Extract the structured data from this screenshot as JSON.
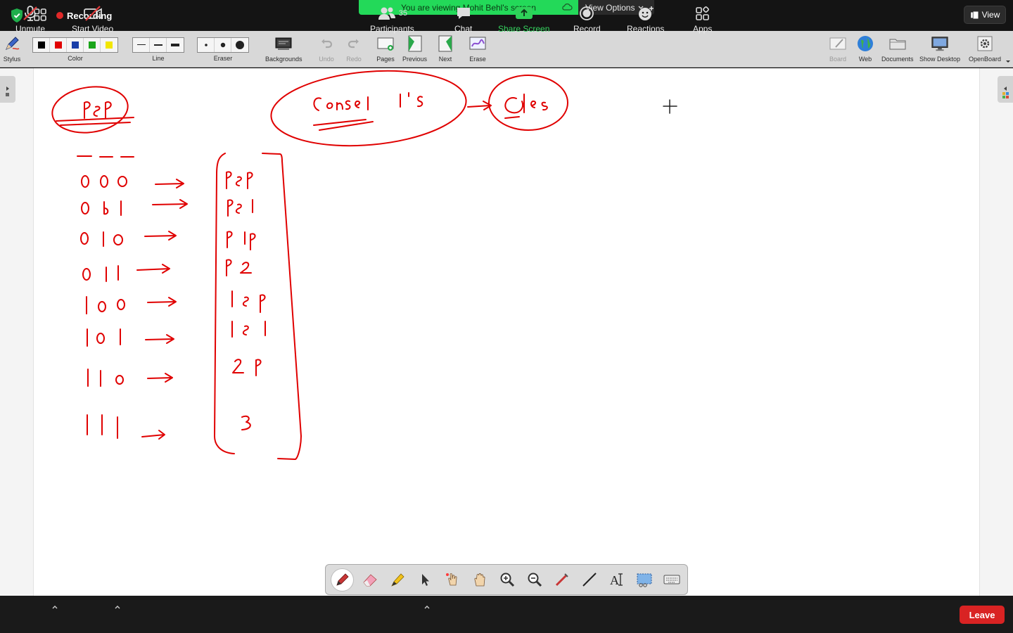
{
  "topbar": {
    "recording_label": "Recording",
    "viewing_banner": "You are viewing Mohit Behl's screen",
    "view_options_label": "View Options",
    "view_label": "View"
  },
  "annotate_toolbar": {
    "stylus": "Stylus",
    "color": "Color",
    "line": "Line",
    "eraser": "Eraser",
    "backgrounds": "Backgrounds",
    "undo": "Undo",
    "redo": "Redo",
    "pages": "Pages",
    "previous": "Previous",
    "next": "Next",
    "erase": "Erase",
    "board": "Board",
    "web": "Web",
    "documents": "Documents",
    "show_desktop": "Show Desktop",
    "openboard": "OpenBoard",
    "colors": [
      "#000000",
      "#e00000",
      "#1a3fa8",
      "#1aa51a",
      "#f2e600"
    ]
  },
  "whiteboard": {
    "ink_color": "#e00000",
    "rows": [
      {
        "bits": "000",
        "result": "pep"
      },
      {
        "bits": "001",
        "result": "pe1"
      },
      {
        "bits": "010",
        "result": "p1p"
      },
      {
        "bits": "011",
        "result": "p2"
      },
      {
        "bits": "100",
        "result": "1ep"
      },
      {
        "bits": "101",
        "result": "1e1"
      },
      {
        "bits": "110",
        "result": "2p"
      },
      {
        "bits": "111",
        "result": "3"
      }
    ]
  },
  "bottombar": {
    "unmute": "Unmute",
    "start_video": "Start Video",
    "participants": "Participants",
    "participant_count": "35",
    "chat": "Chat",
    "share_screen": "Share Screen",
    "record": "Record",
    "reactions": "Reactions",
    "apps": "Apps",
    "leave": "Leave"
  }
}
